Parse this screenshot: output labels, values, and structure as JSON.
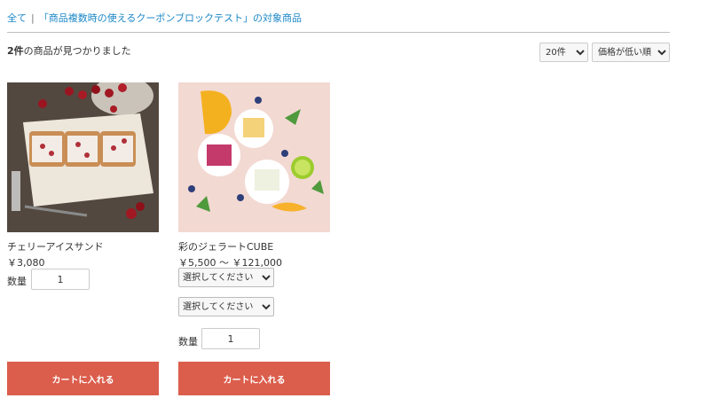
{
  "breadcrumb": {
    "all_label": "全て",
    "separator": "|",
    "category_label": "「商品複数時の使えるクーポンブロックテスト」の対象商品"
  },
  "result": {
    "count": "2件",
    "text": "の商品が見つかりました"
  },
  "controls": {
    "per_page_selected": "20件",
    "sort_selected": "価格が低い順"
  },
  "products": [
    {
      "name": "チェリーアイスサンド",
      "price": "￥3,080",
      "qty_label": "数量",
      "qty_value": "1",
      "cart_label": "カートに入れる",
      "image_icon": "cherry-ice-sandwich-photo"
    },
    {
      "name": "彩のジェラートCUBE",
      "price": "￥5,500 ～ ￥121,000",
      "option1": "選択してください",
      "option2": "選択してください",
      "qty_label": "数量",
      "qty_value": "1",
      "cart_label": "カートに入れる",
      "image_icon": "gelato-cube-photo"
    }
  ],
  "colors": {
    "link": "#1a87c7",
    "button": "#db5d4c"
  }
}
